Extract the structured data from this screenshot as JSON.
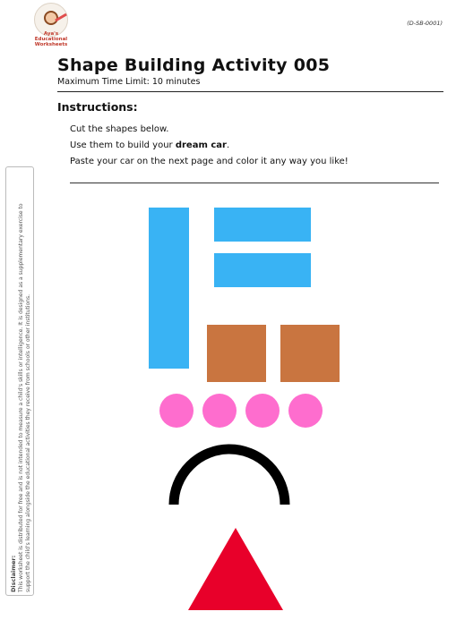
{
  "header": {
    "logo_text_line1": "Aya's Educational",
    "logo_text_line2": "Worksheets",
    "doc_code": "(D-SB-0001)"
  },
  "title": "Shape Building Activity 005",
  "subtitle": "Maximum Time Limit: 10 minutes",
  "instructions": {
    "heading": "Instructions:",
    "line1": "Cut the shapes below.",
    "line2_prefix": "Use them to build your ",
    "line2_bold": "dream car",
    "line2_suffix": ".",
    "line3": "Paste your car on the next page and color it any way you like!"
  },
  "disclaimer": {
    "title": "Disclaimer:",
    "line1": "This worksheet is distributed for free and is not intended to measure a child's skills or intelligence. It is designed as a supplementary exercise to",
    "line2": "support the child's learning alongside the educational activities they receive from schools or other institutions."
  },
  "colors": {
    "blue": "#39b3f4",
    "brown": "#c97540",
    "pink": "#fe6dce",
    "black": "#000000",
    "red": "#e8002a"
  }
}
